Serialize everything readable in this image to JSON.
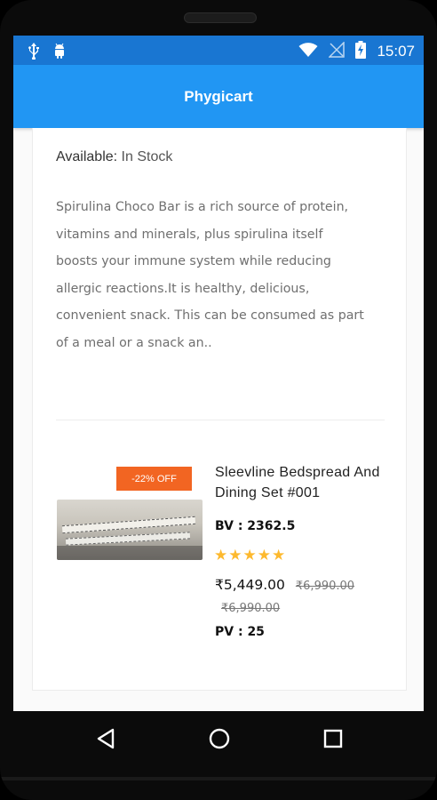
{
  "status_bar": {
    "time": "15:07",
    "left_icons": [
      "usb-icon",
      "android-icon"
    ],
    "right_icons": [
      "wifi-icon",
      "no-signal-icon",
      "battery-charging-icon"
    ]
  },
  "app_bar": {
    "title": "Phygicart"
  },
  "product_details": {
    "availability_label": "Available:",
    "availability_status": "In Stock",
    "description": "Spirulina Choco Bar is a rich source of protein, vitamins and minerals, plus spirulina itself boosts your immune system while reducing allergic reactions.It is healthy, delicious, convenient snack. This can be consumed as part of a meal or a snack an.."
  },
  "related_product": {
    "discount_badge": "-22% OFF",
    "name": "Sleevline Bedspread And Dining Set #001",
    "bv": "BV : 2362.5",
    "rating": 5,
    "rating_max": 5,
    "price": "₹5,449.00",
    "mrp": "₹6,990.00",
    "mrp_secondary": "₹6,990.00",
    "pv": "PV : 25",
    "star_color": "#fdb92e",
    "badge_color": "#f26522"
  },
  "colors": {
    "status_bar": "#1976d2",
    "app_bar": "#2196f3"
  },
  "nav_bar": {
    "buttons": [
      "back-icon",
      "home-icon",
      "recents-icon"
    ]
  }
}
